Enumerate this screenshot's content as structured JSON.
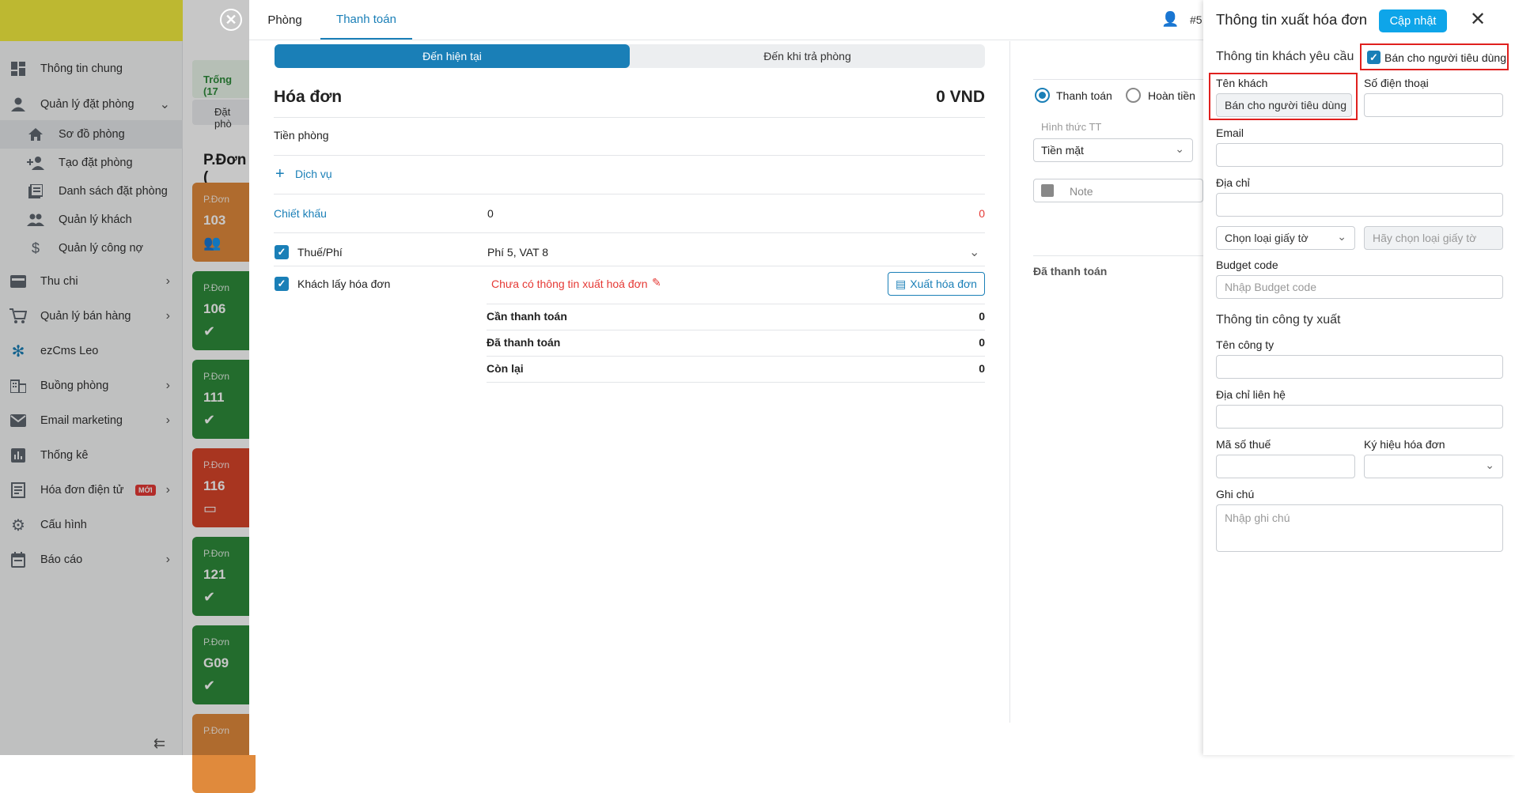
{
  "sidebar": {
    "items": [
      {
        "label": "Thông tin chung",
        "icon": "dashboard-icon"
      },
      {
        "label": "Quản lý đặt phòng",
        "icon": "user-icon"
      },
      {
        "label": "Sơ đồ phòng",
        "icon": "home-icon"
      },
      {
        "label": "Tạo đặt phòng",
        "icon": "add-user-icon"
      },
      {
        "label": "Danh sách đặt phòng",
        "icon": "list-icon"
      },
      {
        "label": "Quản lý khách",
        "icon": "people-icon"
      },
      {
        "label": "Quản lý công nợ",
        "icon": "dollar-icon"
      },
      {
        "label": "Thu chi",
        "icon": "wallet-icon"
      },
      {
        "label": "Quản lý bán hàng",
        "icon": "cart-icon"
      },
      {
        "label": "ezCms Leo",
        "icon": "flower-icon"
      },
      {
        "label": "Buồng phòng",
        "icon": "building-icon"
      },
      {
        "label": "Email marketing",
        "icon": "mail-icon"
      },
      {
        "label": "Thống kê",
        "icon": "chart-icon"
      },
      {
        "label": "Hóa đơn điện tử",
        "icon": "invoice-icon",
        "badge": "MỚI"
      },
      {
        "label": "Cấu hình",
        "icon": "gear-icon"
      },
      {
        "label": "Báo cáo",
        "icon": "calendar-icon"
      }
    ]
  },
  "roomgrid": {
    "filter_label": "Trống (17",
    "booking_tab": "Đặt phò",
    "group_title": "P.Đơn (",
    "rooms": [
      {
        "type": "P.Đơn",
        "number": "103",
        "color": "#e08a3c"
      },
      {
        "type": "P.Đơn",
        "number": "106",
        "color": "#2e8b3a"
      },
      {
        "type": "P.Đơn",
        "number": "111",
        "color": "#2e8b3a"
      },
      {
        "type": "P.Đơn",
        "number": "116",
        "color": "#d8442a"
      },
      {
        "type": "P.Đơn",
        "number": "121",
        "color": "#2e8b3a"
      },
      {
        "type": "P.Đơn",
        "number": "G09",
        "color": "#2e8b3a"
      },
      {
        "type": "P.Đơn",
        "number": "",
        "color": "#e08a3c"
      }
    ]
  },
  "dialog": {
    "tabs": [
      "Phòng",
      "Thanh toán"
    ],
    "booking_ref": "#5",
    "segment": [
      "Đến hiện tại",
      "Đến khi trả phòng"
    ],
    "invoice_title": "Hóa đơn",
    "invoice_total": "0 VND",
    "room_charge_label": "Tiền phòng",
    "service_link": "Dịch vụ",
    "discount_label": "Chiết khấu",
    "discount_value": "0",
    "discount_amount": "0",
    "tax_label": "Thuế/Phí",
    "tax_value": "Phí 5, VAT 8",
    "invoice_req_label": "Khách lấy hóa đơn",
    "invoice_status": "Chưa có thông tin xuất hoá đơn",
    "export_button": "Xuất hóa đơn",
    "summary": [
      {
        "label": "Cần thanh toán",
        "value": "0"
      },
      {
        "label": "Đã thanh toán",
        "value": "0"
      },
      {
        "label": "Còn lại",
        "value": "0"
      }
    ],
    "payment_radio": "Thanh toán",
    "refund_radio": "Hoàn tiền",
    "method_label": "Hình thức TT",
    "method_value": "Tiền mặt",
    "note_placeholder": "Note",
    "paid_label": "Đã thanh toán"
  },
  "panel": {
    "title": "Thông tin xuất hóa đơn",
    "update_button": "Cập nhật",
    "customer_section": "Thông tin khách yêu cầu",
    "consumer_checkbox": "Bán cho người tiêu dùng",
    "guest_name_label": "Tên khách",
    "guest_name_value": "Bán cho người tiêu dùng",
    "phone_label": "Số điện thoại",
    "email_label": "Email",
    "address_label": "Địa chỉ",
    "doc_type_select": "Chọn loại giấy tờ",
    "doc_number_placeholder": "Hãy chọn loại giấy tờ",
    "budget_label": "Budget code",
    "budget_placeholder": "Nhập Budget code",
    "company_section": "Thông tin công ty xuất",
    "company_name_label": "Tên công ty",
    "company_address_label": "Địa chỉ liên hệ",
    "tax_code_label": "Mã số thuế",
    "invoice_symbol_label": "Ký hiệu hóa đơn",
    "note_label": "Ghi chú",
    "note_placeholder": "Nhập ghi chú"
  },
  "colors": {
    "accent": "#1a7fb7",
    "panel_button": "#0ea5e9",
    "highlight": "#e0201e",
    "logo_bar": "#f3ec3f"
  }
}
